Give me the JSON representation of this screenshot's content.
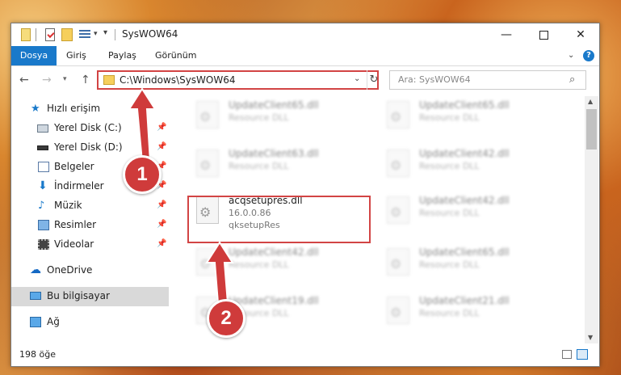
{
  "window": {
    "title": "SysWOW64",
    "controls": {
      "minimize": "—",
      "maximize": "□",
      "close": "✕"
    }
  },
  "ribbon": {
    "tabs": [
      "Dosya",
      "Giriş",
      "Paylaş",
      "Görünüm"
    ],
    "help": "?"
  },
  "address": {
    "path": "C:\\Windows\\SysWOW64",
    "search_placeholder": "Ara: SysWOW64"
  },
  "sidebar": {
    "items": [
      {
        "label": "Hızlı erişim",
        "icon": "star-icon"
      },
      {
        "label": "Yerel Disk (C:)",
        "icon": "drive-icon",
        "pinned": true
      },
      {
        "label": "Yerel Disk (D:)",
        "icon": "drive-icon",
        "pinned": true
      },
      {
        "label": "Belgeler",
        "icon": "document-icon",
        "pinned": true
      },
      {
        "label": "İndirmeler",
        "icon": "download-icon",
        "pinned": true
      },
      {
        "label": "Müzik",
        "icon": "music-icon",
        "pinned": true
      },
      {
        "label": "Resimler",
        "icon": "pictures-icon",
        "pinned": true
      },
      {
        "label": "Videolar",
        "icon": "video-icon",
        "pinned": true
      },
      {
        "label": "OneDrive",
        "icon": "cloud-icon"
      },
      {
        "label": "Bu bilgisayar",
        "icon": "computer-icon",
        "selected": true
      },
      {
        "label": "Ağ",
        "icon": "network-icon"
      }
    ]
  },
  "files": {
    "highlighted": {
      "name": "acqsetupres.dll",
      "version": "16.0.0.86",
      "description": "qksetupRes"
    },
    "blurred": [
      {
        "name": "UpdateClient65.dll",
        "description": "Resource DLL"
      },
      {
        "name": "UpdateClient65.dll",
        "description": "Resource DLL"
      },
      {
        "name": "UpdateClient63.dll",
        "description": "Resource DLL"
      },
      {
        "name": "UpdateClient42.dll",
        "description": "Resource DLL"
      },
      {
        "name": "UpdateClient42.dll",
        "description": "Resource DLL"
      },
      {
        "name": "UpdateClient42.dll",
        "description": "Resource DLL"
      },
      {
        "name": "UpdateClient65.dll",
        "description": "Resource DLL"
      },
      {
        "name": "UpdateClient19.dll",
        "description": "Resource DLL"
      },
      {
        "name": "UpdateClient21.dll",
        "description": "Resource DLL"
      }
    ]
  },
  "status": {
    "count": "198 öğe"
  },
  "annotations": {
    "step1": "1",
    "step2": "2"
  },
  "colors": {
    "accent": "#1979ca",
    "annotation": "#cf3b3b"
  }
}
